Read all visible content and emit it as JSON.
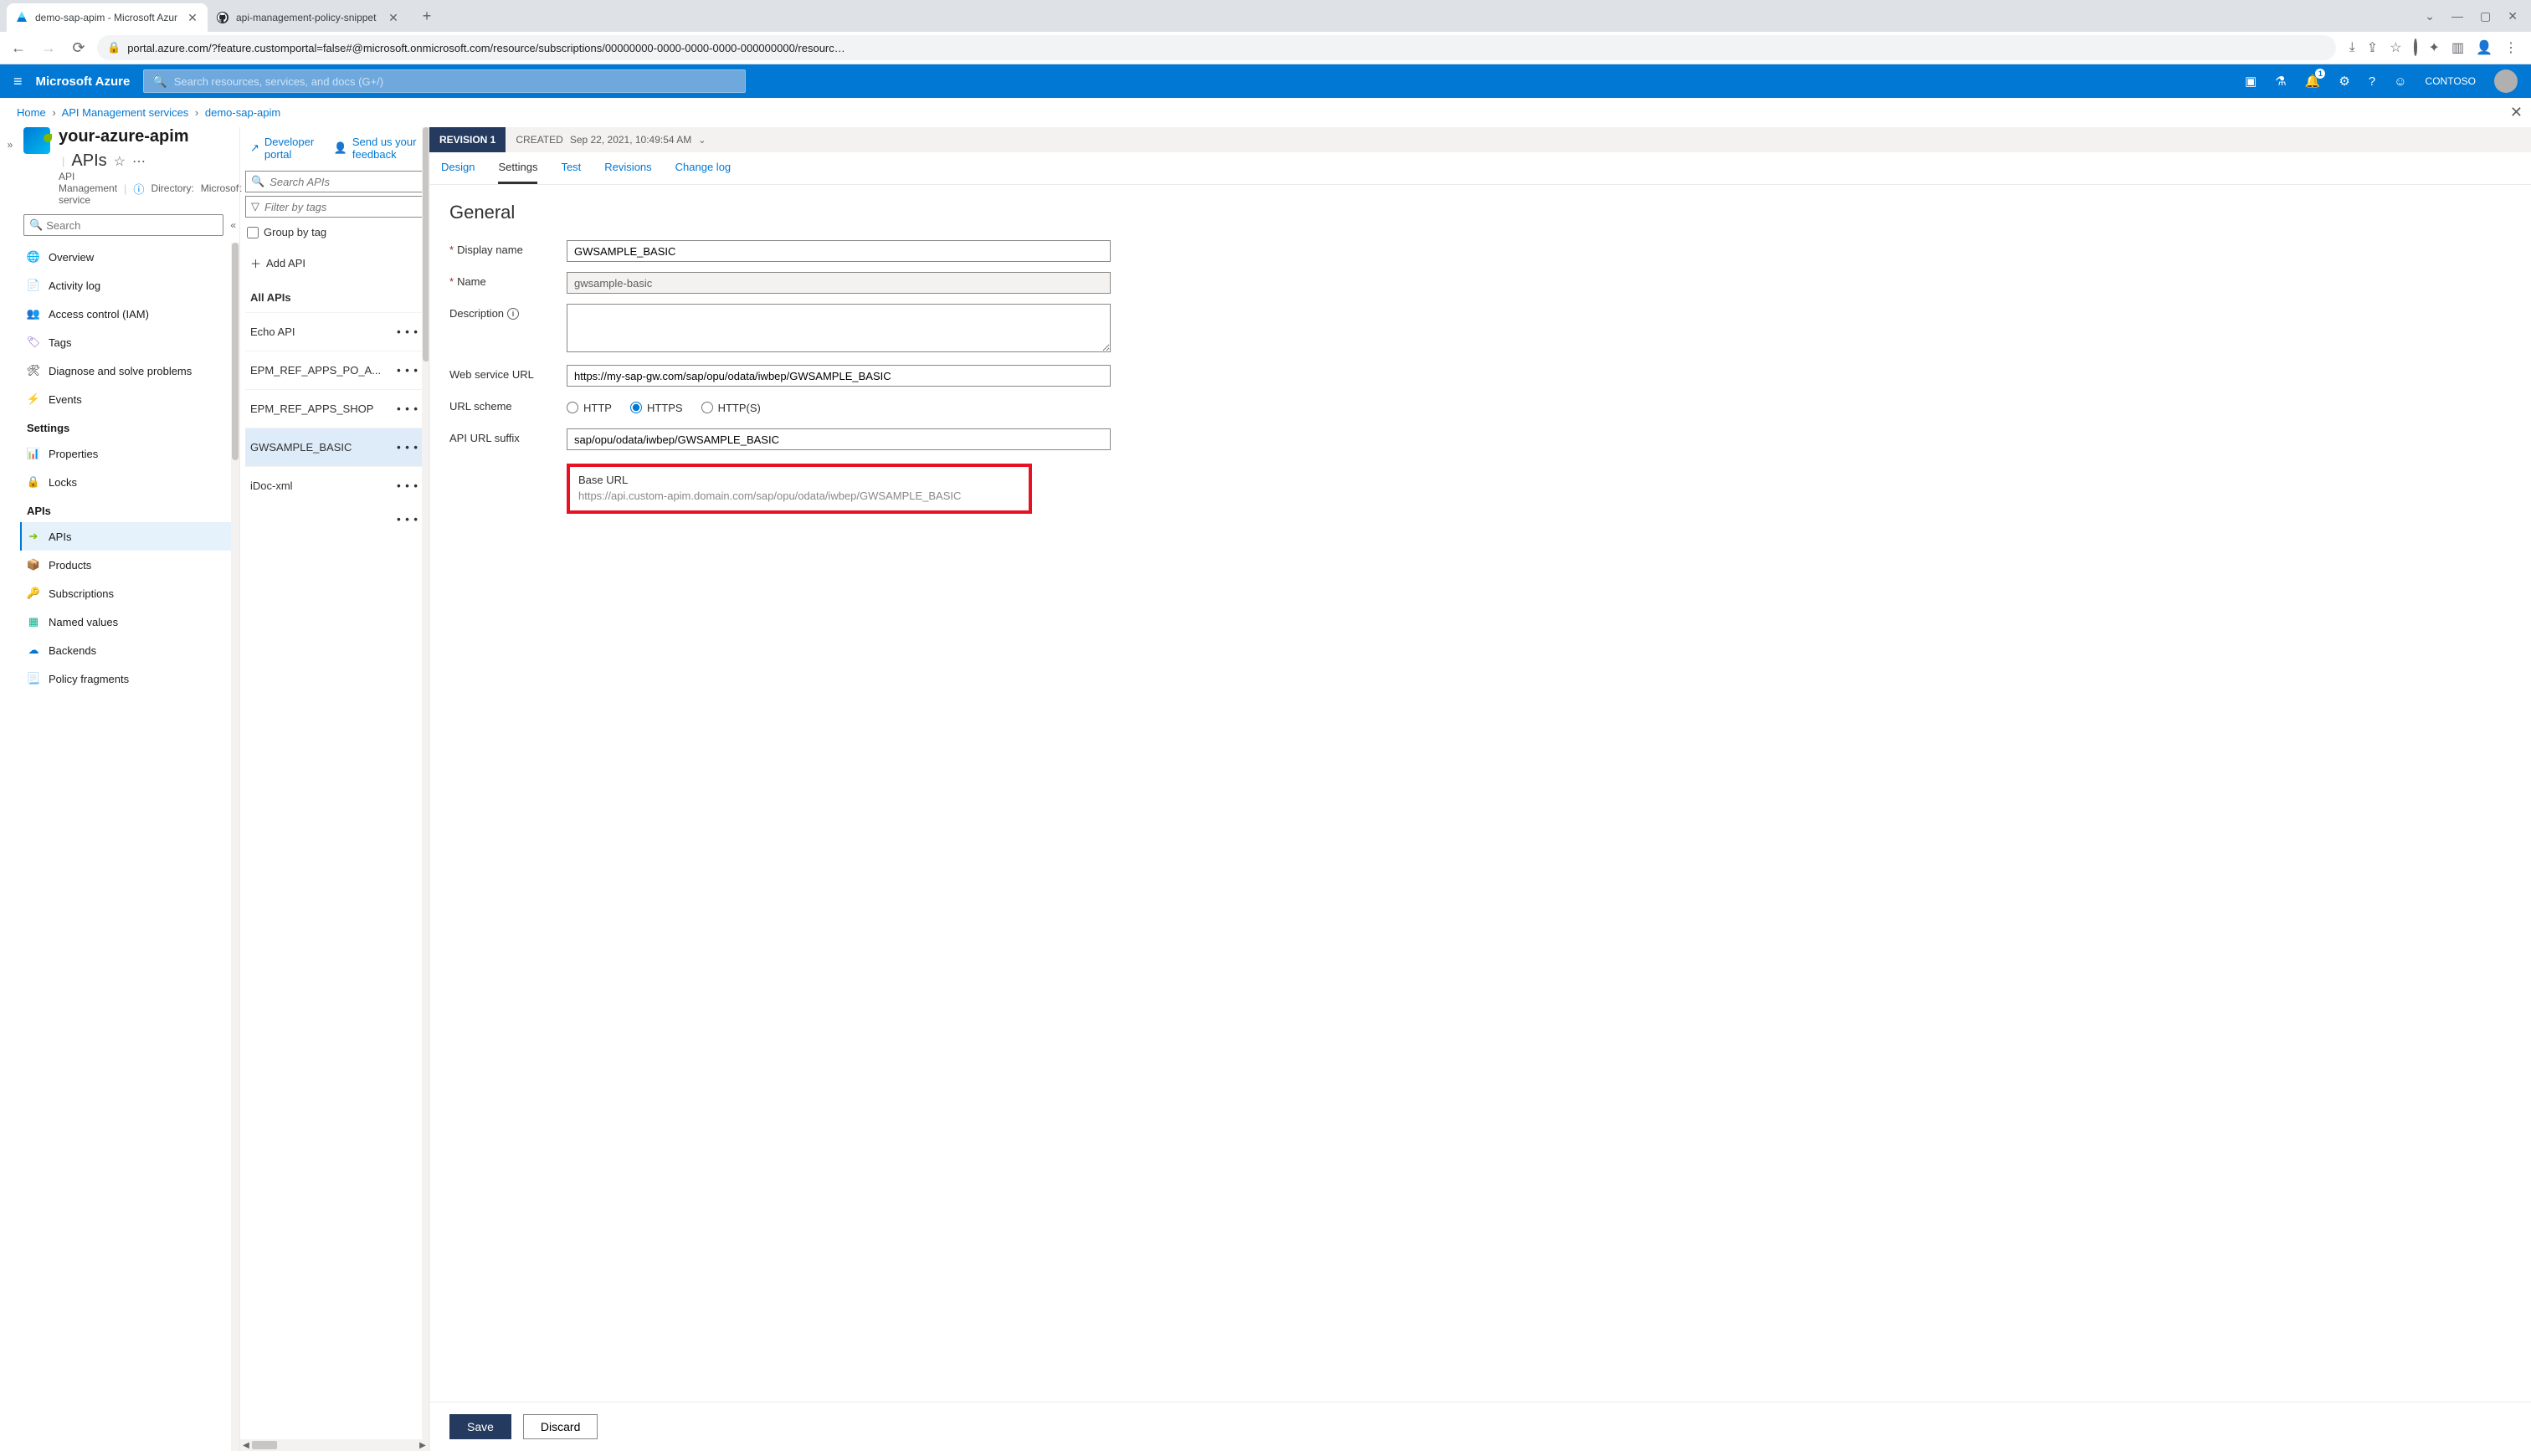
{
  "browser": {
    "tabs": [
      {
        "title": "demo-sap-apim - Microsoft Azur",
        "favicon": "azure"
      },
      {
        "title": "api-management-policy-snippet",
        "favicon": "github"
      }
    ],
    "url_display": "portal.azure.com/?feature.customportal=false#@microsoft.onmicrosoft.com/resource/subscriptions/00000000-0000-0000-0000-000000000/resourc…",
    "window_controls": {
      "min": "V",
      "dash": "—",
      "box": "▢",
      "close": "✕"
    }
  },
  "azure": {
    "brand": "Microsoft Azure",
    "search_placeholder": "Search resources, services, and docs (G+/)",
    "notification_count": "1",
    "tenant": "CONTOSO"
  },
  "breadcrumb": {
    "home": "Home",
    "crumb1": "API Management services",
    "crumb2": "demo-sap-apim"
  },
  "resource": {
    "name": "your-azure-apim",
    "section": "APIs",
    "type": "API Management service",
    "directory_label": "Directory:",
    "directory_value": "Microsoft"
  },
  "nav_search_placeholder": "Search",
  "nav": {
    "top": [
      {
        "label": "Overview",
        "icon": "🌐",
        "cls": "c-blue"
      },
      {
        "label": "Activity log",
        "icon": "📄",
        "cls": "c-blue"
      },
      {
        "label": "Access control (IAM)",
        "icon": "👥",
        "cls": "c-blue"
      },
      {
        "label": "Tags",
        "icon": "🏷",
        "cls": "c-purple"
      },
      {
        "label": "Diagnose and solve problems",
        "icon": "🛠",
        "cls": ""
      },
      {
        "label": "Events",
        "icon": "⚡",
        "cls": "c-yellow"
      }
    ],
    "settings_title": "Settings",
    "settings": [
      {
        "label": "Properties",
        "icon": "📊",
        "cls": "c-blue"
      },
      {
        "label": "Locks",
        "icon": "🔒",
        "cls": "c-blue"
      }
    ],
    "apis_title": "APIs",
    "apis": [
      {
        "label": "APIs",
        "icon": "➔",
        "cls": "c-green",
        "selected": true
      },
      {
        "label": "Products",
        "icon": "📦",
        "cls": "c-blue"
      },
      {
        "label": "Subscriptions",
        "icon": "🔑",
        "cls": "c-yellow"
      },
      {
        "label": "Named values",
        "icon": "▦",
        "cls": "c-teal"
      },
      {
        "label": "Backends",
        "icon": "☁",
        "cls": "c-blue"
      },
      {
        "label": "Policy fragments",
        "icon": "📃",
        "cls": "c-blue"
      }
    ]
  },
  "api_toolbar": {
    "dev_portal": "Developer portal",
    "feedback": "Send us your feedback"
  },
  "api_list": {
    "search_placeholder": "Search APIs",
    "filter_placeholder": "Filter by tags",
    "group_label": "Group by tag",
    "add_label": "Add API",
    "all_label": "All APIs",
    "items": [
      "Echo API",
      "EPM_REF_APPS_PO_A...",
      "EPM_REF_APPS_SHOP",
      "GWSAMPLE_BASIC",
      "iDoc-xml"
    ],
    "selected_index": 3
  },
  "revision": {
    "badge": "REVISION 1",
    "created_label": "CREATED",
    "created_value": "Sep 22, 2021, 10:49:54 AM"
  },
  "detail_tabs": [
    "Design",
    "Settings",
    "Test",
    "Revisions",
    "Change log"
  ],
  "detail_active_tab": 1,
  "form": {
    "heading": "General",
    "display_name_label": "Display name",
    "display_name": "GWSAMPLE_BASIC",
    "name_label": "Name",
    "name": "gwsample-basic",
    "description_label": "Description",
    "description": "",
    "web_url_label": "Web service URL",
    "web_url": "https://my-sap-gw.com/sap/opu/odata/iwbep/GWSAMPLE_BASIC",
    "url_scheme_label": "URL scheme",
    "scheme_opts": {
      "http": "HTTP",
      "https": "HTTPS",
      "httpss": "HTTP(S)"
    },
    "suffix_label": "API URL suffix",
    "suffix": "sap/opu/odata/iwbep/GWSAMPLE_BASIC",
    "base_url_label": "Base URL",
    "base_url": "https://api.custom-apim.domain.com/sap/opu/odata/iwbep/GWSAMPLE_BASIC"
  },
  "buttons": {
    "save": "Save",
    "discard": "Discard"
  }
}
